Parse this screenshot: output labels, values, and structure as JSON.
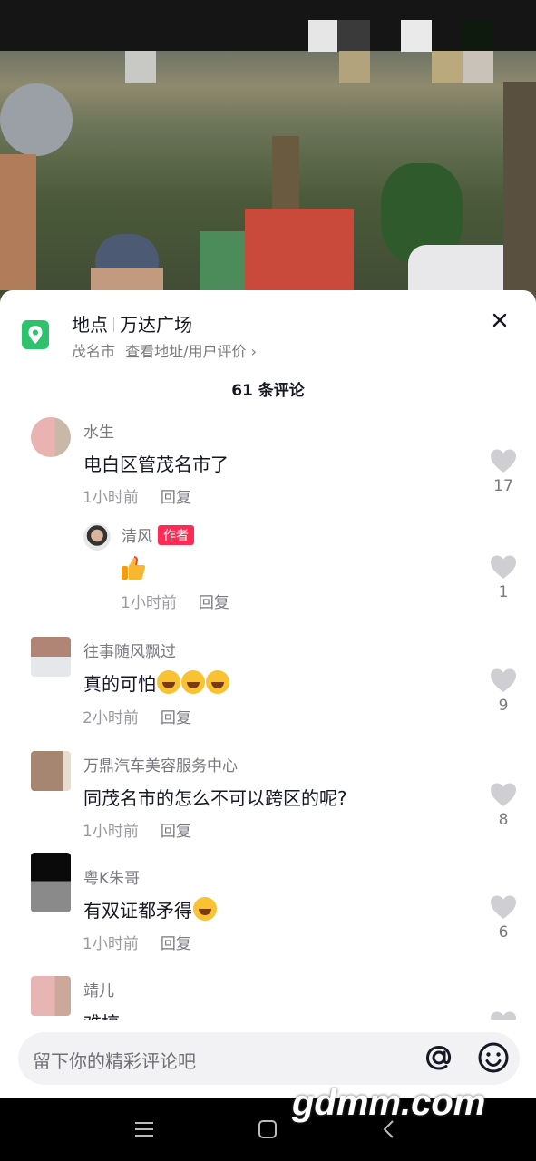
{
  "location": {
    "label": "地点",
    "name": "万达广场",
    "city": "茂名市",
    "link": "查看地址/用户评价 ›"
  },
  "comments_count": "61 条评论",
  "comments": [
    {
      "user": "水生",
      "text": "电白区管茂名市了",
      "time": "1小时前",
      "reply": "回复",
      "likes": "17"
    },
    {
      "user": "清风",
      "badge": "作者",
      "text": "",
      "time": "1小时前",
      "reply": "回复",
      "likes": "1",
      "emoji": "thumbs-up"
    },
    {
      "user": "往事随风飘过",
      "text": "真的可怕",
      "time": "2小时前",
      "reply": "回复",
      "likes": "9",
      "emoji": "laughing-crying x3"
    },
    {
      "user": "万鼎汽车美容服务中心",
      "text": "同茂名市的怎么不可以跨区的呢?",
      "time": "1小时前",
      "reply": "回复",
      "likes": "8"
    },
    {
      "user": "粤K朱哥",
      "text": "有双证都矛得",
      "time": "1小时前",
      "reply": "回复",
      "likes": "6",
      "emoji": "laughing-crying"
    },
    {
      "user": "靖儿",
      "text": "难搞",
      "time": "",
      "reply": "",
      "likes": ""
    }
  ],
  "input": {
    "placeholder": "留下你的精彩评论吧"
  },
  "watermark": "gdmm.com",
  "colors": {
    "accent_red": "#fe2c55",
    "location_green": "#2dc26b"
  }
}
